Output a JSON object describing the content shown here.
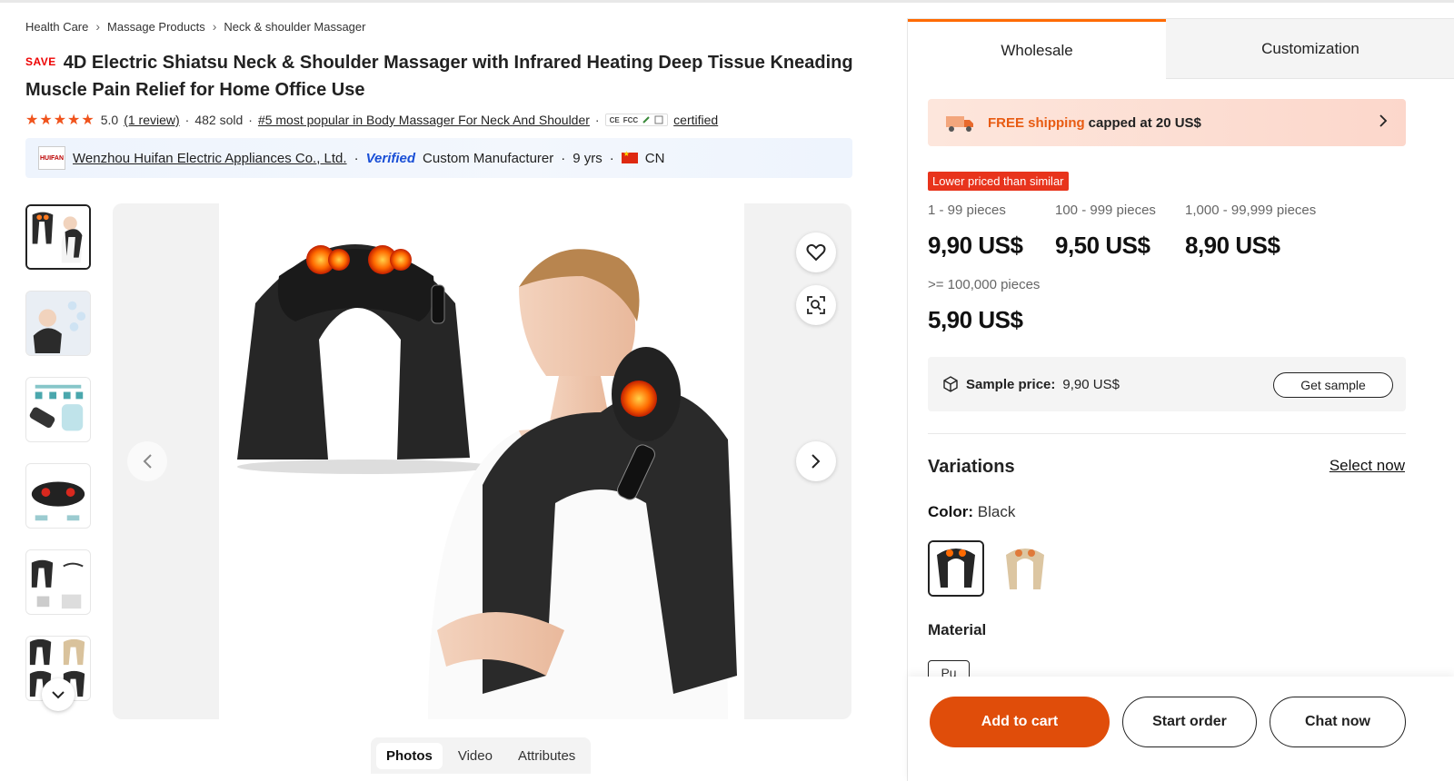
{
  "breadcrumb": [
    "Health Care",
    "Massage Products",
    "Neck & shoulder Massager"
  ],
  "product": {
    "save_badge": "SAVE",
    "title": "4D Electric Shiatsu Neck & Shoulder Massager with Infrared Heating Deep Tissue Kneading Muscle Pain Relief for Home Office Use",
    "rating": "5.0",
    "stars": "★★★★★",
    "reviews": "(1 review)",
    "sold": "482 sold",
    "rank": "#5 most popular in Body Massager For Neck And Shoulder",
    "certs": [
      "CE",
      "FCC"
    ],
    "certified": "certified"
  },
  "supplier": {
    "logo_text": "HUIFAN",
    "name": "Wenzhou Huifan Electric Appliances Co., Ltd.",
    "verified": "Verified",
    "type": "Custom Manufacturer",
    "years": "9 yrs",
    "country": "CN"
  },
  "media_tabs": [
    "Photos",
    "Video",
    "Attributes"
  ],
  "panel": {
    "tabs": [
      "Wholesale",
      "Customization"
    ],
    "shipping_free": "FREE shipping",
    "shipping_rest": "capped at 20 US$",
    "lower_badge": "Lower priced than similar",
    "tiers": [
      {
        "qty": "1 - 99 pieces",
        "price": "9,90 US$"
      },
      {
        "qty": "100 - 999 pieces",
        "price": "9,50 US$"
      },
      {
        "qty": "1,000 - 99,999 pieces",
        "price": "8,90 US$"
      },
      {
        "qty": ">= 100,000 pieces",
        "price": "5,90 US$"
      }
    ],
    "sample_label": "Sample price:",
    "sample_value": "9,90 US$",
    "sample_button": "Get sample",
    "variations_title": "Variations",
    "select_now": "Select now",
    "color_label": "Color:",
    "color_value": "Black",
    "material_title": "Material",
    "material_value": "Pu",
    "buttons": {
      "cart": "Add to cart",
      "order": "Start order",
      "chat": "Chat now"
    }
  },
  "colors": {
    "accent": "#e04d0a",
    "orange": "#ff6a00",
    "verified_blue": "#1a4fd6"
  }
}
